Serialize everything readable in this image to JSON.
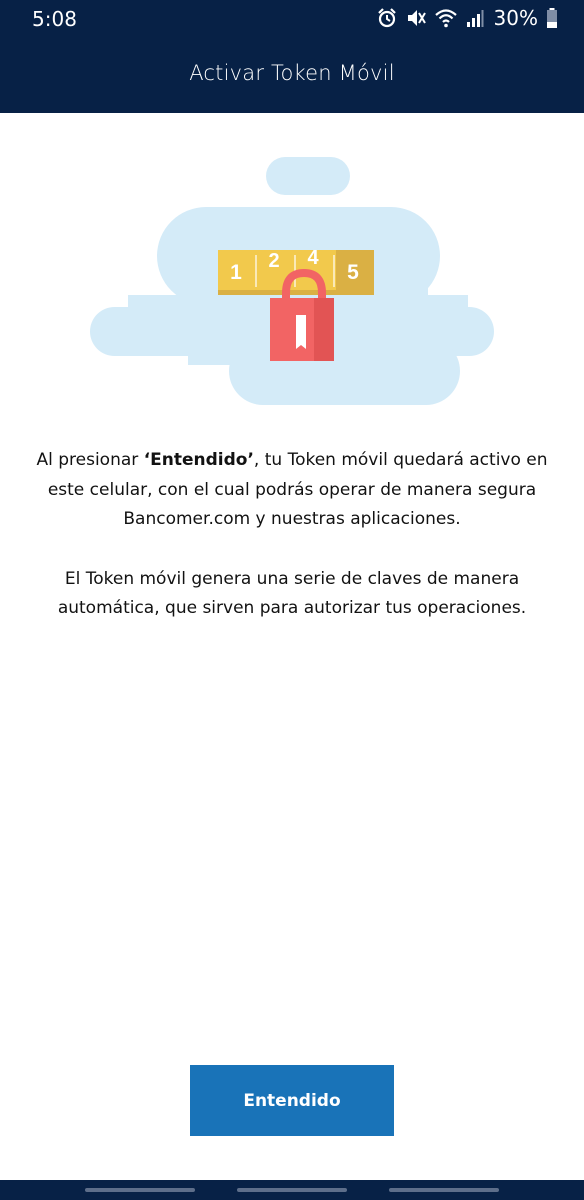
{
  "status_bar": {
    "time": "5:08",
    "battery_percent": "30%",
    "icons": [
      "alarm-icon",
      "mute-icon",
      "wifi-icon",
      "signal-icon",
      "battery-icon"
    ]
  },
  "header": {
    "title": "Activar Token Móvil"
  },
  "illustration": {
    "digits": [
      "1",
      "2",
      "4",
      "5"
    ],
    "icons": [
      "cloud-icon",
      "keypad-strip",
      "padlock-icon"
    ],
    "colors": {
      "cloud": "#d4ebf8",
      "strip": "#f2c94c",
      "lock": "#f26464"
    }
  },
  "content": {
    "paragraph1": {
      "prefix": "Al presionar ",
      "emphasis": "‘Entendido’",
      "suffix": ", tu Token móvil quedará activo en este celular, con el cual podrás operar de manera segura Bancomer.com y nuestras aplicaciones."
    },
    "paragraph2": "El Token móvil genera una serie de claves de manera automática, que sirven para autorizar tus operaciones."
  },
  "actions": {
    "confirm_label": "Entendido"
  },
  "colors": {
    "navy": "#072146",
    "primary_button": "#1973b8"
  }
}
